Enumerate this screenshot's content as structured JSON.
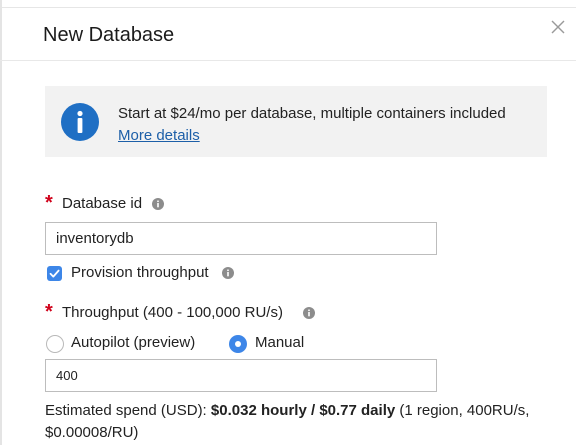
{
  "dialog": {
    "title": "New Database"
  },
  "info": {
    "text": "Start at $24/mo per database, multiple containers included",
    "link": "More details"
  },
  "database_id": {
    "label": "Database id",
    "value": "inventorydb"
  },
  "provision": {
    "label": "Provision throughput",
    "checked": true
  },
  "throughput": {
    "label": "Throughput (400 - 100,000 RU/s)",
    "options": [
      "Autopilot (preview)",
      "Manual"
    ],
    "selected": "Manual",
    "value": "400"
  },
  "estimate": {
    "prefix": "Estimated spend (USD): ",
    "hourly": "$0.032 hourly",
    "separator": " / ",
    "daily": "$0.77 daily",
    "suffix": " (1 region, 400RU/s, $0.00008/RU)"
  },
  "colors": {
    "accent": "#3d86e8",
    "link": "#1d5fa8",
    "required": "#d0021b",
    "info_icon": "#1f6fc4"
  }
}
